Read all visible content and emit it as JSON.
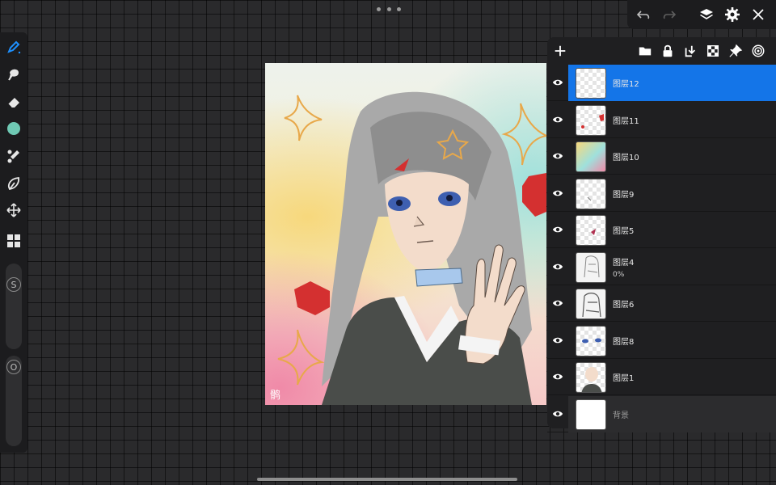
{
  "toolbar": {
    "tools": [
      {
        "name": "brush-icon"
      },
      {
        "name": "smudge-icon"
      },
      {
        "name": "eraser-icon"
      },
      {
        "name": "color-swatch-icon"
      },
      {
        "name": "adjustments-icon"
      },
      {
        "name": "selection-icon"
      },
      {
        "name": "transform-icon"
      },
      {
        "name": "layers-grid-icon"
      }
    ],
    "size_slider_label": "S",
    "opacity_slider_label": "O",
    "current_color": "#6fc9b4",
    "accent": "#1e90ff"
  },
  "topbar": {
    "buttons": [
      "undo-icon",
      "redo-icon",
      "layers-icon",
      "settings-icon",
      "close-icon"
    ]
  },
  "layers_panel": {
    "header_buttons": [
      "add-layer-icon",
      "folder-icon",
      "lock-icon",
      "merge-down-icon",
      "checkerboard-icon",
      "pin-icon",
      "radar-icon"
    ],
    "layers": [
      {
        "name": "图层12",
        "sub": "",
        "active": true
      },
      {
        "name": "图层11",
        "sub": "",
        "active": false
      },
      {
        "name": "图层10",
        "sub": "",
        "active": false
      },
      {
        "name": "图层9",
        "sub": "",
        "active": false
      },
      {
        "name": "图层5",
        "sub": "",
        "active": false
      },
      {
        "name": "图层4",
        "sub": "0%",
        "active": false
      },
      {
        "name": "图层6",
        "sub": "",
        "active": false
      },
      {
        "name": "图层8",
        "sub": "",
        "active": false
      },
      {
        "name": "图层1",
        "sub": "",
        "active": false
      },
      {
        "name": "背景",
        "sub": "",
        "active": false
      }
    ],
    "active_color": "#1475e8"
  },
  "artwork": {
    "signature": "鹘"
  }
}
